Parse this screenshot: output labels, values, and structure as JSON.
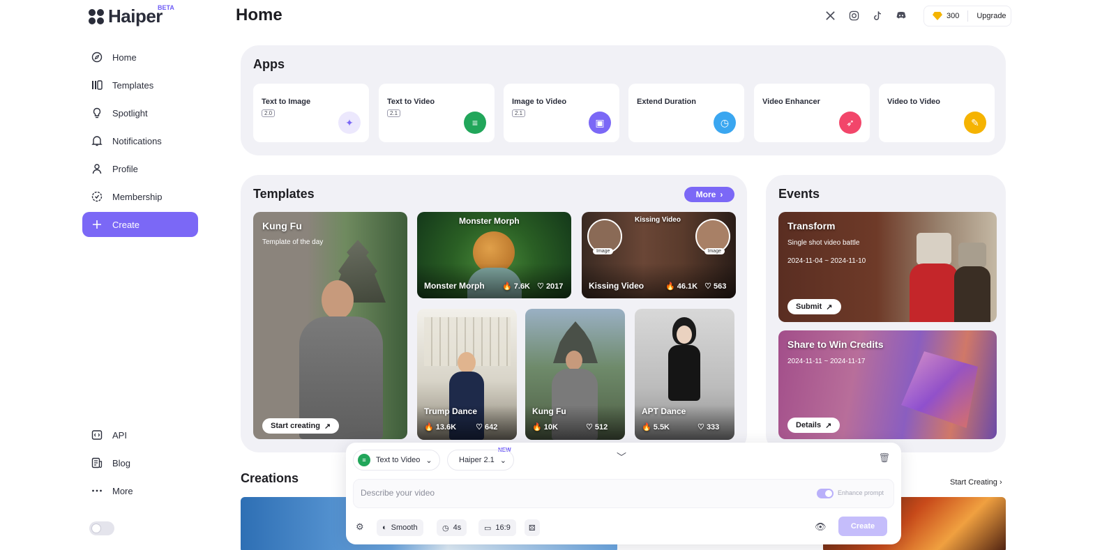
{
  "brand": {
    "name": "Haiper",
    "badge": "BETA"
  },
  "page_title": "Home",
  "sidebar": {
    "items": [
      {
        "label": "Home",
        "icon": "compass-icon"
      },
      {
        "label": "Templates",
        "icon": "templates-icon"
      },
      {
        "label": "Spotlight",
        "icon": "bulb-icon"
      },
      {
        "label": "Notifications",
        "icon": "bell-icon"
      },
      {
        "label": "Profile",
        "icon": "user-icon"
      },
      {
        "label": "Membership",
        "icon": "badge-icon"
      },
      {
        "label": "Create",
        "icon": "plus-icon"
      }
    ],
    "bottom": [
      {
        "label": "API",
        "icon": "code-icon"
      },
      {
        "label": "Blog",
        "icon": "blog-icon"
      },
      {
        "label": "More",
        "icon": "more-icon"
      }
    ]
  },
  "header": {
    "socials": [
      "x-icon",
      "instagram-icon",
      "tiktok-icon",
      "discord-icon"
    ],
    "credits": "300",
    "upgrade_label": "Upgrade"
  },
  "apps": {
    "title": "Apps",
    "cards": [
      {
        "name": "Text to Image",
        "version": "2.0",
        "color": "#ece8fd"
      },
      {
        "name": "Text to Video",
        "version": "2.1",
        "color": "#21a65a"
      },
      {
        "name": "Image to Video",
        "version": "2.1",
        "color": "#7b68f6"
      },
      {
        "name": "Extend Duration",
        "version": "",
        "color": "#3aa6f0"
      },
      {
        "name": "Video Enhancer",
        "version": "",
        "color": "#f2466a"
      },
      {
        "name": "Video to Video",
        "version": "",
        "color": "#f5b301"
      }
    ]
  },
  "templates": {
    "title": "Templates",
    "more_label": "More",
    "featured": {
      "title": "Kung Fu",
      "subtitle": "Template of the day",
      "cta": "Start creating"
    },
    "tiles": [
      {
        "title": "Monster Morph",
        "overlay": "Monster Morph",
        "uses": "7.6K",
        "likes": "2017"
      },
      {
        "title": "Kissing Video",
        "overlay": "Kissing Video",
        "uses": "46.1K",
        "likes": "563",
        "badge": "Image"
      },
      {
        "title": "Trump Dance",
        "uses": "13.6K",
        "likes": "642"
      },
      {
        "title": "Kung Fu",
        "uses": "10K",
        "likes": "512"
      },
      {
        "title": "APT Dance",
        "uses": "5.5K",
        "likes": "333"
      }
    ]
  },
  "events": {
    "title": "Events",
    "items": [
      {
        "title": "Transform",
        "subtitle": "Single shot video battle",
        "dates": "2024-11-04 ~ 2024-11-10",
        "cta": "Submit"
      },
      {
        "title": "Share to Win Credits",
        "subtitle": "",
        "dates": "2024-11-11 ~ 2024-11-17",
        "cta": "Details"
      }
    ]
  },
  "creations": {
    "title": "Creations",
    "start_label": "Start Creating"
  },
  "composer": {
    "mode": "Text to Video",
    "model": "Haiper 2.1",
    "new_badge": "NEW",
    "placeholder": "Describe your video",
    "enhance_label": "Enhance prompt",
    "motion": "Smooth",
    "duration": "4s",
    "aspect": "16:9",
    "create_label": "Create"
  }
}
